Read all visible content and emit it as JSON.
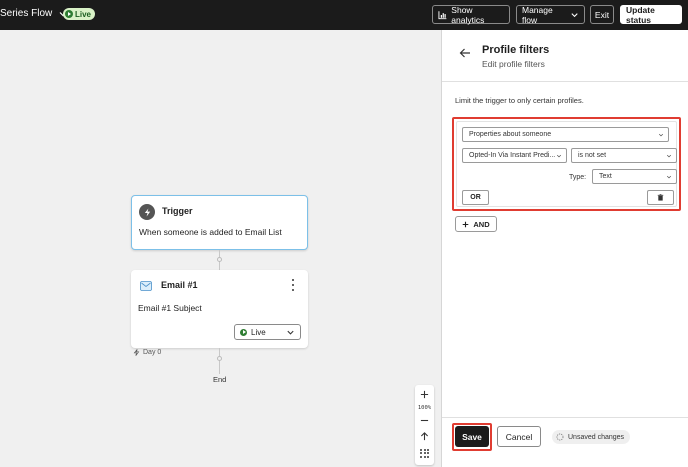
{
  "header": {
    "flow_name": "Series Flow",
    "status_badge": "Live",
    "show_analytics": "Show analytics",
    "manage_flow": "Manage flow",
    "exit": "Exit",
    "update_status": "Update status"
  },
  "canvas": {
    "trigger": {
      "title": "Trigger",
      "description": "When someone is added to Email List"
    },
    "email": {
      "title": "Email #1",
      "subject": "Email #1 Subject",
      "status": "Live"
    },
    "delay_label": "Day 0",
    "end_label": "End",
    "zoom": {
      "level": "100%"
    }
  },
  "panel": {
    "title": "Profile filters",
    "subtitle": "Edit profile filters",
    "description": "Limit the trigger to only certain profiles.",
    "filter": {
      "condition_type": "Properties about someone",
      "property": "Opted-In Via Instant Predi...",
      "operator": "is not set",
      "type_label": "Type:",
      "type_value": "Text",
      "or_label": "OR"
    },
    "and_label": "AND",
    "footer": {
      "save": "Save",
      "cancel": "Cancel",
      "unsaved": "Unsaved changes"
    }
  },
  "colors": {
    "header_bg": "#1b1b1b",
    "highlight": "#e03c31",
    "live_green": "#2e7d32",
    "trigger_border": "#7cc0e8"
  }
}
